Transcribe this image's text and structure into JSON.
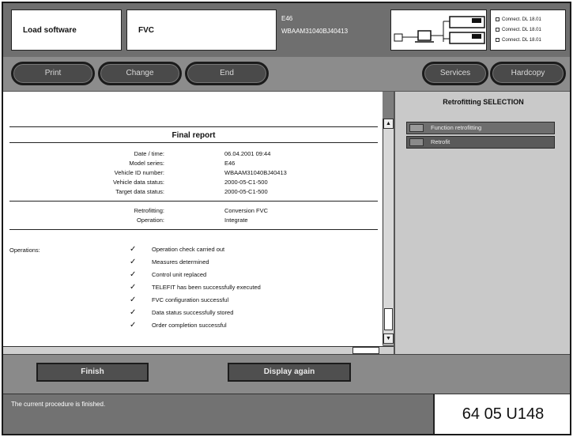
{
  "header": {
    "app_label": "Load software",
    "vehicle_label": "FVC",
    "info_line1": "E46",
    "info_line2": "WBAAM31040BJ40413"
  },
  "status_panel": {
    "lines": [
      "Connect. DL 18.01",
      "Connect. DL 18.01",
      "Connect. DL 18.01"
    ]
  },
  "toolbar": {
    "print": "Print",
    "change": "Change",
    "end": "End",
    "services": "Services",
    "hardcopy": "Hardcopy"
  },
  "report": {
    "title": "Final report",
    "vehicle_info": [
      {
        "key": "Date / time:",
        "value": "06.04.2001 09:44"
      },
      {
        "key": "Model series:",
        "value": "E46"
      },
      {
        "key": "Vehicle ID number:",
        "value": "WBAAM31040BJ40413"
      },
      {
        "key": "Vehicle data status:",
        "value": "2000-05-C1-500"
      },
      {
        "key": "Target data status:",
        "value": "2000-05-C1-500"
      }
    ],
    "procedure_info": [
      {
        "key": "Retrofitting:",
        "value": "Conversion FVC"
      },
      {
        "key": "Operation:",
        "value": "Integrate"
      }
    ],
    "operations_label": "Operations:",
    "operations": [
      "Operation check carried out",
      "Measures determined",
      "Control unit replaced",
      "TELEFIT has been successfully executed",
      "FVC configuration successful",
      "Data status successfully stored",
      "Order completion successful"
    ]
  },
  "selection_panel": {
    "title": "Retrofitting SELECTION",
    "items": [
      "Function retrofitting",
      "Retrofit"
    ]
  },
  "actions": {
    "finish": "Finish",
    "display_again": "Display again"
  },
  "status_bar": {
    "message": "The current procedure is finished.",
    "code": "64 05 U148"
  }
}
